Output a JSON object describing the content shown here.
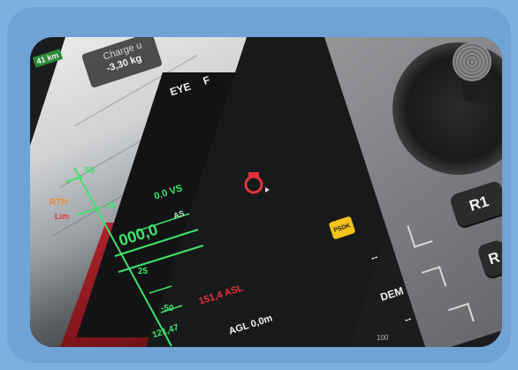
{
  "speed_chip": "41 km",
  "charge_label": "Charge u",
  "charge_value": "-3,30 kg",
  "eye_label": "EYE",
  "f_label": "F",
  "rth_label": "RTH",
  "lim_label": "Lim",
  "alt_tick_50": "50",
  "alt_tick_25": "25",
  "alt_tick_25b": "25",
  "alt_tick_m50": "-50",
  "alt_main": "000,0",
  "vs_value": "0.0 VS",
  "as_label": "AS",
  "amsl_value": "151,4 ASL",
  "bottom_value": "121,47",
  "agl_value": "AGL 0,0m",
  "psdk_label": "PSDK",
  "dem_label": "DEM",
  "r1_label": "R1",
  "r2_label": "R",
  "scale_100": "100",
  "arrow_label_1": "--",
  "arrow_label_2": "--",
  "colors": {
    "hud_green": "#3fe36d",
    "hud_orange": "#f08a2a",
    "hud_red": "#e3343a",
    "frame_blue": "#6fa3d6",
    "psdk_yellow": "#f3c31a"
  }
}
